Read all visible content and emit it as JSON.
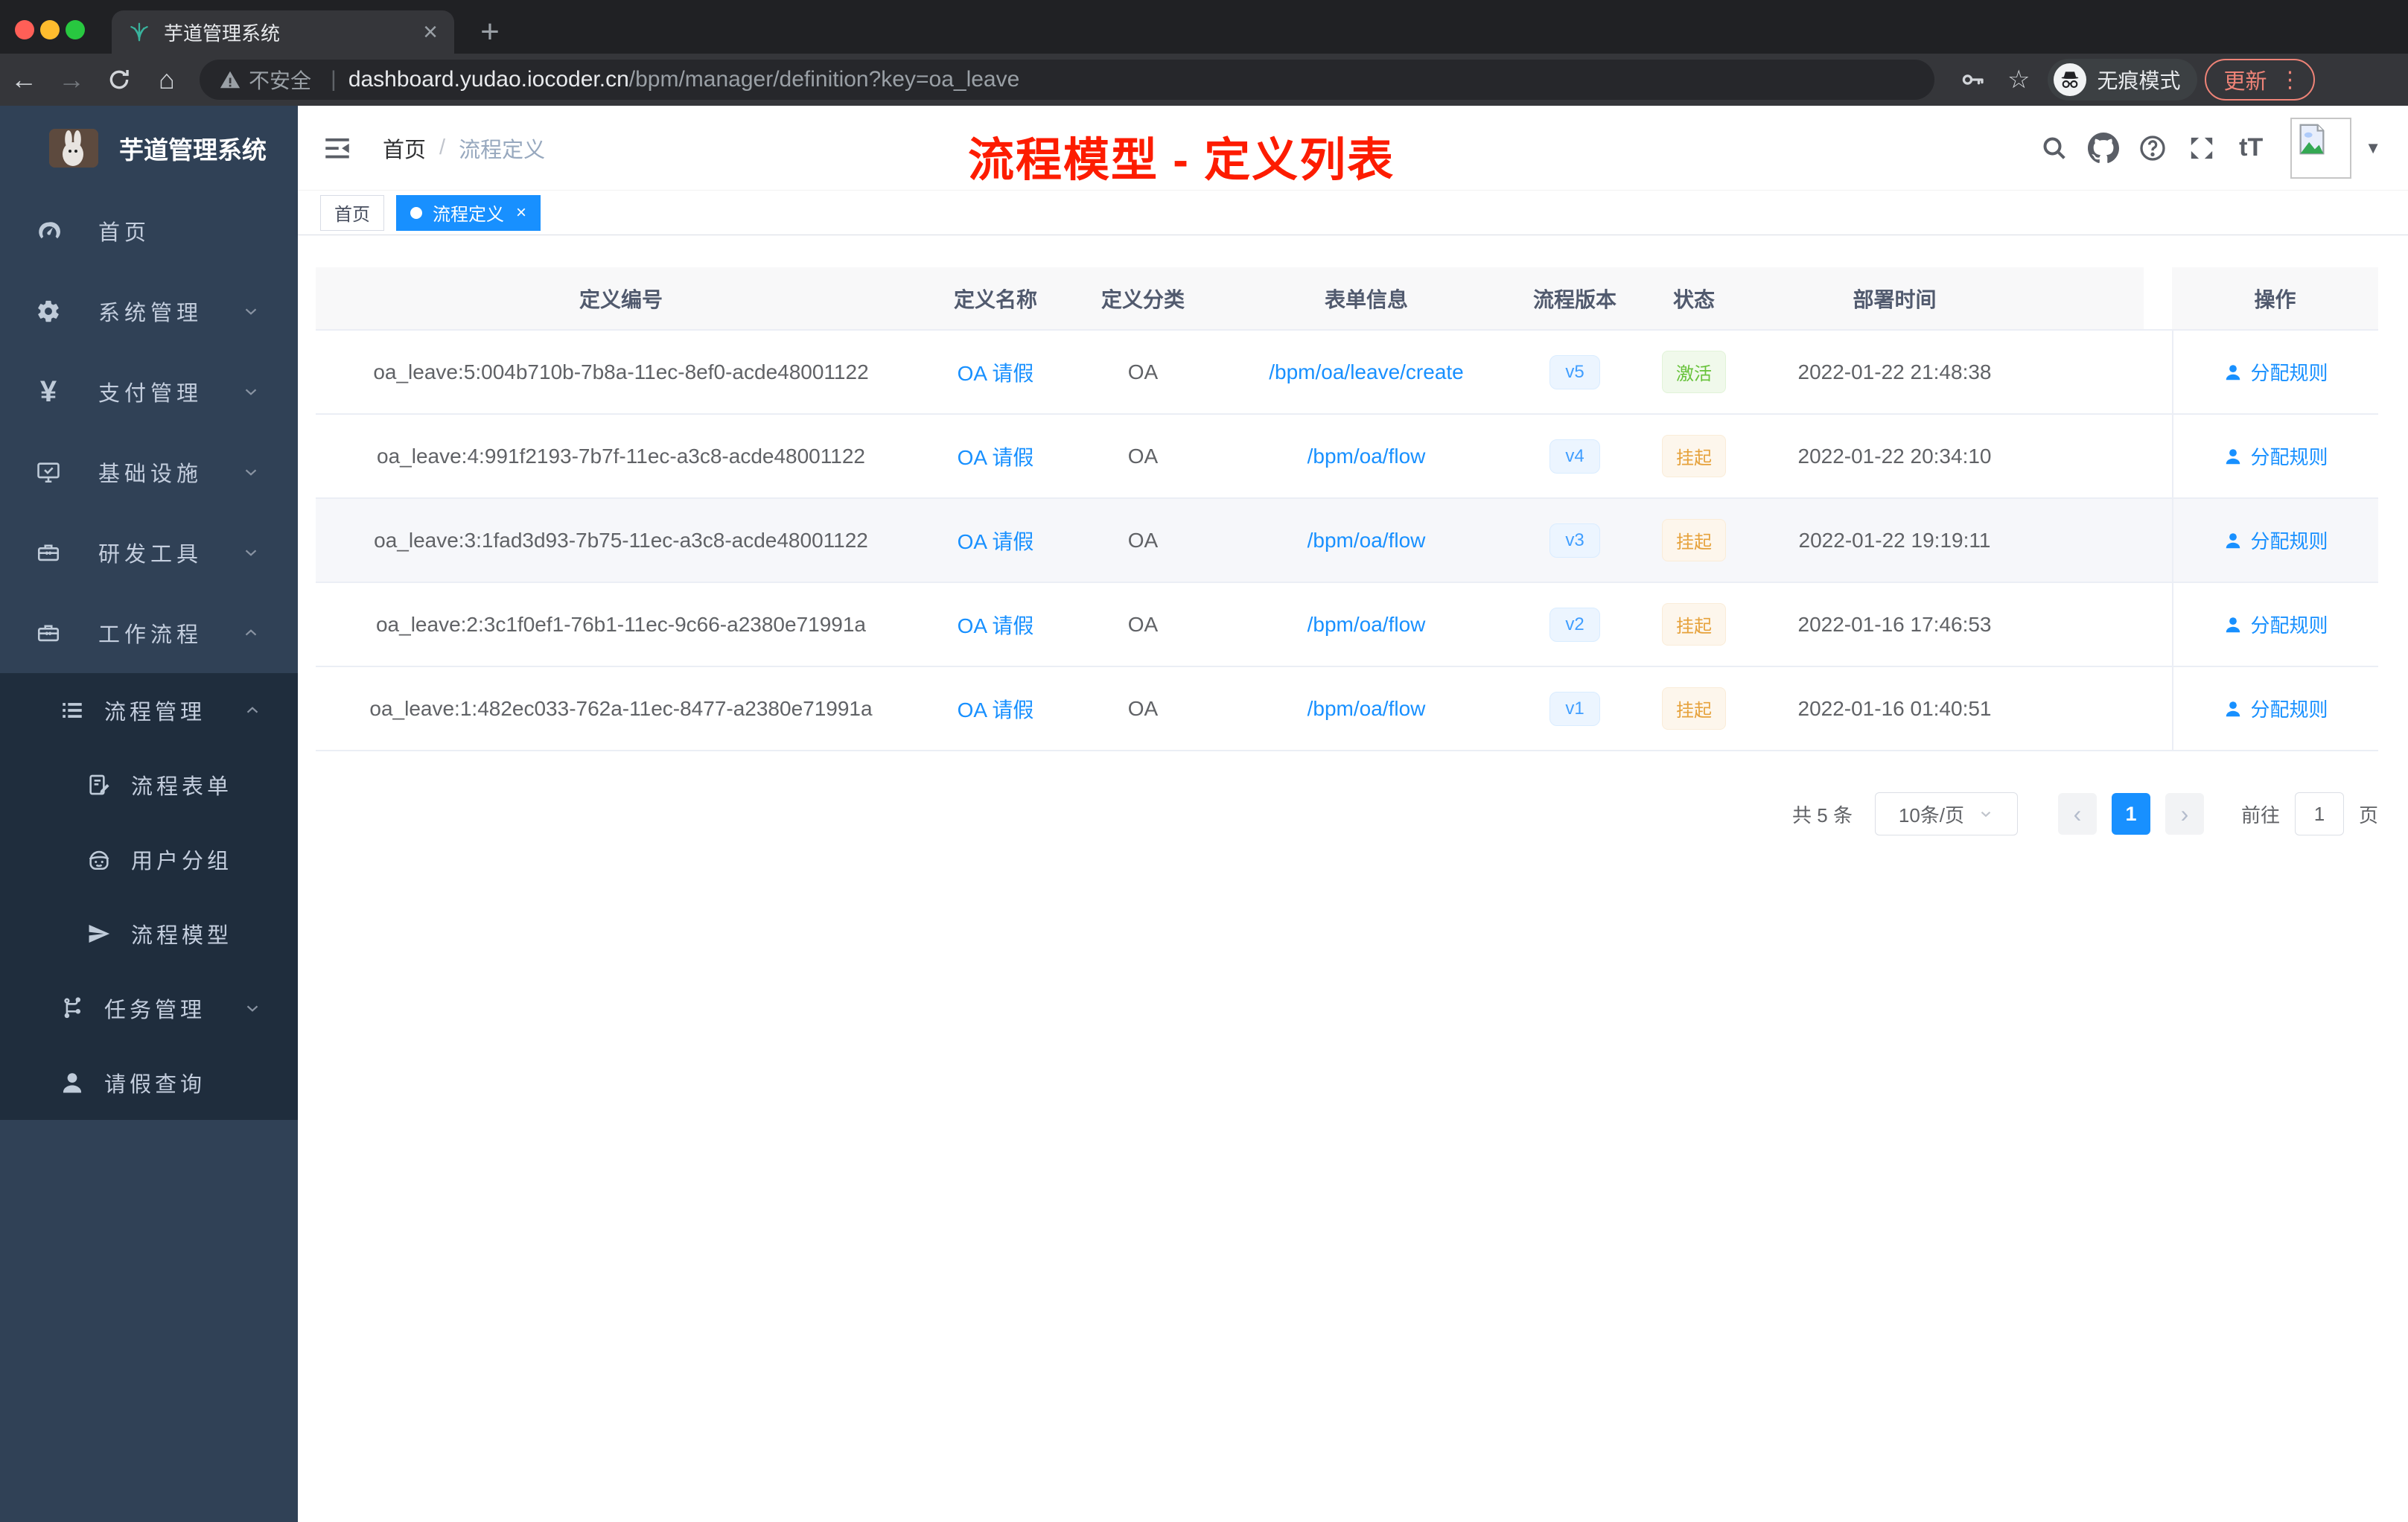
{
  "colors": {
    "accent": "#1890ff",
    "version_blue": "#409eff",
    "success_green": "#67c23a",
    "warning_orange": "#e6a23c",
    "sidebar_bg": "#304156",
    "submenu_bg": "#1f2d3d",
    "active_tag": "#1890ff"
  },
  "browser": {
    "tab_title": "芋道管理系统",
    "security_label": "不安全",
    "url_domain": "dashboard.yudao.iocoder.cn",
    "url_path": "/bpm/manager/definition?key=oa_leave",
    "incognito_label": "无痕模式",
    "update_label": "更新"
  },
  "icons": {
    "back": "←",
    "forward": "→",
    "home": "⌂",
    "star": "☆",
    "more": "⋮",
    "plus": "+",
    "close": "×",
    "caret_down": "▼",
    "bullet": "",
    "breadcrumb_sep": "/",
    "help": "?",
    "font_size": "tT",
    "yen": "¥",
    "prev": "‹",
    "next": "›",
    "select_caret": "⌄"
  },
  "sidebar": {
    "logo_title": "芋道管理系统",
    "items": [
      {
        "label": "首页"
      },
      {
        "label": "系统管理"
      },
      {
        "label": "支付管理"
      },
      {
        "label": "基础设施"
      },
      {
        "label": "研发工具"
      },
      {
        "label": "工作流程"
      }
    ],
    "sub_items": [
      {
        "label": "流程管理"
      },
      {
        "label": "流程表单"
      },
      {
        "label": "用户分组"
      },
      {
        "label": "流程模型"
      },
      {
        "label": "任务管理"
      },
      {
        "label": "请假查询"
      }
    ]
  },
  "navbar": {
    "breadcrumb": {
      "home": "首页",
      "current": "流程定义"
    }
  },
  "annotation": "流程模型 - 定义列表",
  "tags": [
    {
      "label": "首页"
    },
    {
      "label": "流程定义"
    }
  ],
  "table": {
    "headers": [
      "定义编号",
      "定义名称",
      "定义分类",
      "表单信息",
      "流程版本",
      "状态",
      "部署时间",
      "操作"
    ],
    "rows": [
      {
        "id": "oa_leave:5:004b710b-7b8a-11ec-8ef0-acde48001122",
        "name": "OA 请假",
        "category": "OA",
        "form": "/bpm/oa/leave/create",
        "version": "v5",
        "status": "激活",
        "deploy_time": "2022-01-22 21:48:38",
        "action": "分配规则"
      },
      {
        "id": "oa_leave:4:991f2193-7b7f-11ec-a3c8-acde48001122",
        "name": "OA 请假",
        "category": "OA",
        "form": "/bpm/oa/flow",
        "version": "v4",
        "status": "挂起",
        "deploy_time": "2022-01-22 20:34:10",
        "action": "分配规则"
      },
      {
        "id": "oa_leave:3:1fad3d93-7b75-11ec-a3c8-acde48001122",
        "name": "OA 请假",
        "category": "OA",
        "form": "/bpm/oa/flow",
        "version": "v3",
        "status": "挂起",
        "deploy_time": "2022-01-22 19:19:11",
        "action": "分配规则"
      },
      {
        "id": "oa_leave:2:3c1f0ef1-76b1-11ec-9c66-a2380e71991a",
        "name": "OA 请假",
        "category": "OA",
        "form": "/bpm/oa/flow",
        "version": "v2",
        "status": "挂起",
        "deploy_time": "2022-01-16 17:46:53",
        "action": "分配规则"
      },
      {
        "id": "oa_leave:1:482ec033-762a-11ec-8477-a2380e71991a",
        "name": "OA 请假",
        "category": "OA",
        "form": "/bpm/oa/flow",
        "version": "v1",
        "status": "挂起",
        "deploy_time": "2022-01-16 01:40:51",
        "action": "分配规则"
      }
    ]
  },
  "pagination": {
    "total": "共 5 条",
    "page_size": "10条/页",
    "page": "1",
    "goto_label": "前往",
    "goto_value": "1",
    "unit": "页"
  }
}
